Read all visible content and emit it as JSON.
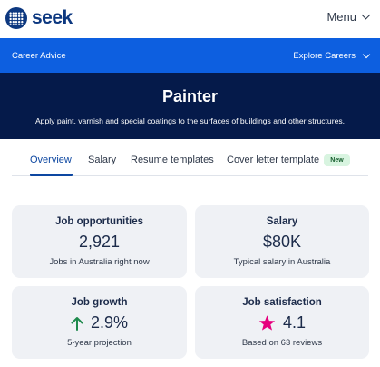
{
  "header": {
    "logo_text": "seek",
    "menu_label": "Menu"
  },
  "navbar": {
    "career_advice": "Career Advice",
    "explore_careers": "Explore Careers"
  },
  "hero": {
    "title": "Painter",
    "description": "Apply paint, varnish and special coatings to the surfaces of buildings and other structures."
  },
  "tabs": [
    {
      "label": "Overview",
      "active": true
    },
    {
      "label": "Salary"
    },
    {
      "label": "Resume templates"
    },
    {
      "label": "Cover letter template"
    }
  ],
  "badge_new": "New",
  "stats": {
    "job_opportunities": {
      "title": "Job opportunities",
      "value": "2,921",
      "sub": "Jobs in Australia right now"
    },
    "salary": {
      "title": "Salary",
      "value": "$80K",
      "sub": "Typical salary in Australia"
    },
    "job_growth": {
      "title": "Job growth",
      "value": "2.9%",
      "sub": "5-year projection",
      "icon": "arrow-up-icon"
    },
    "job_satisfaction": {
      "title": "Job satisfaction",
      "value": "4.1",
      "sub": "Based on 63 reviews",
      "icon": "star-icon"
    }
  },
  "colors": {
    "brand_navy": "#0d3880",
    "nav_blue": "#0d5fe0",
    "hero_bg": "#051a4a",
    "growth_green": "#1e8a4c",
    "star_pink": "#e6007e",
    "badge_bg": "#d8f4e0"
  }
}
